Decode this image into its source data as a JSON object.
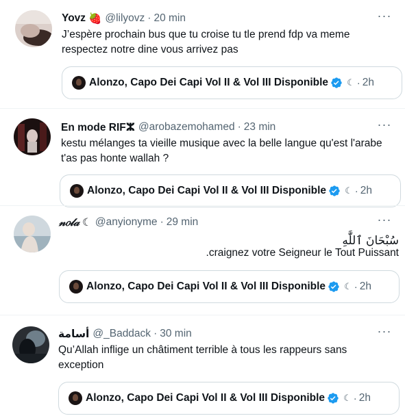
{
  "tweets": [
    {
      "name": "Yovz",
      "name_emoji": "🍓",
      "handle": "@lilyovz",
      "time": "20 min",
      "text": "J’espère prochain bus que tu croise tu tle prend fdp va meme respectez notre dine vous arrivez pas",
      "quote": {
        "name": "Alonzo, Capo Dei Capi Vol II & Vol III Disponible",
        "moon": "☾",
        "time": "2h"
      }
    },
    {
      "name": "En mode RIFⵣ",
      "handle": "@arobazemohamed",
      "time": "23 min",
      "text": "kestu mélanges ta vieille musique avec la belle langue qu'est l'arabe t'as pas honte wallah ?",
      "quote": {
        "name": "Alonzo, Capo Dei Capi Vol II & Vol III Disponible",
        "moon": "☾",
        "time": "2h"
      }
    },
    {
      "name": "𝓃𝑜𝓁𝒶",
      "name_emoji": "☾",
      "handle": "@anyionyme",
      "time": "29 min",
      "text_line1": "سُبْحَانَ ٱللَّٰهِ",
      "text_line2": ".craignez votre Seigneur le Tout Puissant",
      "quote": {
        "name": "Alonzo, Capo Dei Capi Vol II & Vol III Disponible",
        "moon": "☾",
        "time": "2h"
      }
    },
    {
      "name": "أسامة",
      "handle": "@_Baddack",
      "time": "30 min",
      "text": "Qu’Allah inflige un châtiment terrible à tous les rappeurs sans exception",
      "quote": {
        "name": "Alonzo, Capo Dei Capi Vol II & Vol III Disponible",
        "moon": "☾",
        "time": "2h"
      }
    }
  ],
  "ui": {
    "more_glyph": "···",
    "separator": "·",
    "verified_color": "#1d9bf0",
    "secondary_text_color": "#536471"
  }
}
